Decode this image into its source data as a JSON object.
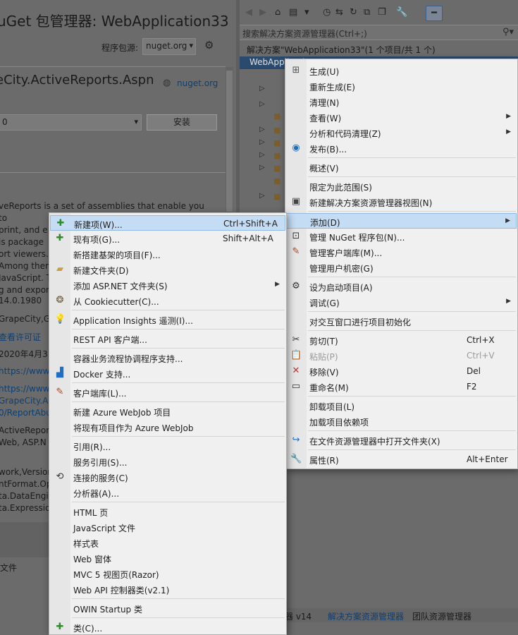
{
  "nuget": {
    "title": "uGet 包管理器: WebApplication33",
    "source_label": "程序包源:",
    "source_value": "nuget.org",
    "package_title": "eCity.ActiveReports.Aspn",
    "package_link": "nuget.org",
    "version_value": "0",
    "install_label": "安装",
    "description_lines": [
      "veReports is a set of assemblies that enable you to",
      "print, and e",
      "is package",
      "ort viewers.",
      "Among them",
      "JavaScript. T",
      "g and expor"
    ],
    "details": [
      {
        "text": "14.0.1980",
        "link": false
      },
      {
        "text": "GrapeCity,G",
        "link": false
      },
      {
        "text": "查看许可证",
        "link": true
      },
      {
        "text": "2020年4月3日",
        "link": false
      },
      {
        "text": "https://www",
        "link": true
      },
      {
        "text": "https://www",
        "link": true
      },
      {
        "text": "GrapeCity.Ac",
        "link": true
      },
      {
        "text": "0/ReportAbu",
        "link": true
      },
      {
        "text": "ActiveRepor",
        "link": false
      },
      {
        "text": "Web, ASP.N",
        "link": false
      },
      {
        "text": "work,Version",
        "link": false
      },
      {
        "text": "ntFormat.Op",
        "link": false
      },
      {
        "text": "ta.DataEngin",
        "link": false
      },
      {
        "text": "ta.Expressio",
        "link": false
      }
    ],
    "file_label": "文件"
  },
  "solution_explorer": {
    "search_placeholder": "搜索解决方案资源管理器(Ctrl+;)",
    "solution_row": "解决方案\"WebApplication33\"(1 个项目/共 1 个)",
    "project_row": "WebApplication33",
    "bottom_tabs": [
      "器 v14",
      "解决方案资源管理器",
      "团队资源管理器"
    ]
  },
  "project_menu": {
    "items": [
      {
        "label": "生成(U)",
        "shortcut": "",
        "icon": "build-icon"
      },
      {
        "label": "重新生成(E)",
        "shortcut": "",
        "icon": ""
      },
      {
        "label": "清理(N)",
        "shortcut": "",
        "icon": ""
      },
      {
        "label": "查看(W)",
        "shortcut": "",
        "icon": "",
        "submenu": true
      },
      {
        "label": "分析和代码清理(Z)",
        "shortcut": "",
        "icon": "",
        "submenu": true
      },
      {
        "label": "发布(B)...",
        "shortcut": "",
        "icon": "globe-icon"
      },
      {
        "label": "概述(V)",
        "shortcut": "",
        "icon": ""
      },
      {
        "label": "限定为此范围(S)",
        "shortcut": "",
        "icon": ""
      },
      {
        "label": "新建解决方案资源管理器视图(N)",
        "shortcut": "",
        "icon": "new-view-icon"
      },
      {
        "label": "添加(D)",
        "shortcut": "",
        "icon": "",
        "submenu": true,
        "highlighted": true
      },
      {
        "label": "管理 NuGet 程序包(N)...",
        "shortcut": "",
        "icon": "nuget-icon"
      },
      {
        "label": "管理客户端库(M)...",
        "shortcut": "",
        "icon": "client-library-icon"
      },
      {
        "label": "管理用户机密(G)",
        "shortcut": "",
        "icon": ""
      },
      {
        "label": "设为启动项目(A)",
        "shortcut": "",
        "icon": "gear-icon"
      },
      {
        "label": "调试(G)",
        "shortcut": "",
        "icon": "",
        "submenu": true
      },
      {
        "label": "对交互窗口进行项目初始化",
        "shortcut": "",
        "icon": ""
      },
      {
        "label": "剪切(T)",
        "shortcut": "Ctrl+X",
        "icon": "scissors-icon"
      },
      {
        "label": "粘贴(P)",
        "shortcut": "Ctrl+V",
        "icon": "paste-icon",
        "disabled": true
      },
      {
        "label": "移除(V)",
        "shortcut": "Del",
        "icon": "remove-icon"
      },
      {
        "label": "重命名(M)",
        "shortcut": "F2",
        "icon": "rename-icon"
      },
      {
        "label": "卸载项目(L)",
        "shortcut": "",
        "icon": ""
      },
      {
        "label": "加载项目依赖项",
        "shortcut": "",
        "icon": ""
      },
      {
        "label": "在文件资源管理器中打开文件夹(X)",
        "shortcut": "",
        "icon": "open-folder-icon"
      },
      {
        "label": "属性(R)",
        "shortcut": "Alt+Enter",
        "icon": "wrench-icon"
      }
    ]
  },
  "add_menu": {
    "items": [
      {
        "label": "新建项(W)...",
        "shortcut": "Ctrl+Shift+A",
        "icon": "new-item-icon",
        "highlighted": true
      },
      {
        "label": "现有项(G)...",
        "shortcut": "Shift+Alt+A",
        "icon": "existing-item-icon"
      },
      {
        "label": "新搭建基架的项目(F)...",
        "shortcut": "",
        "icon": ""
      },
      {
        "label": "新建文件夹(D)",
        "shortcut": "",
        "icon": "new-folder-icon"
      },
      {
        "label": "添加 ASP.NET 文件夹(S)",
        "shortcut": "",
        "icon": "",
        "submenu": true
      },
      {
        "label": "从 Cookiecutter(C)...",
        "shortcut": "",
        "icon": "cookiecutter-icon"
      },
      {
        "label": "Application Insights 遥测(I)...",
        "shortcut": "",
        "icon": "insights-icon"
      },
      {
        "label": "REST API 客户端...",
        "shortcut": "",
        "icon": ""
      },
      {
        "label": "容器业务流程协调程序支持...",
        "shortcut": "",
        "icon": ""
      },
      {
        "label": "Docker 支持...",
        "shortcut": "",
        "icon": "docker-icon"
      },
      {
        "label": "客户端库(L)...",
        "shortcut": "",
        "icon": "client-library-icon"
      },
      {
        "label": "新建 Azure WebJob 项目",
        "shortcut": "",
        "icon": ""
      },
      {
        "label": "将现有项目作为 Azure WebJob",
        "shortcut": "",
        "icon": ""
      },
      {
        "label": "引用(R)...",
        "shortcut": "",
        "icon": ""
      },
      {
        "label": "服务引用(S)...",
        "shortcut": "",
        "icon": ""
      },
      {
        "label": "连接的服务(C)",
        "shortcut": "",
        "icon": "connected-service-icon"
      },
      {
        "label": "分析器(A)...",
        "shortcut": "",
        "icon": ""
      },
      {
        "label": "HTML 页",
        "shortcut": "",
        "icon": ""
      },
      {
        "label": "JavaScript 文件",
        "shortcut": "",
        "icon": ""
      },
      {
        "label": "样式表",
        "shortcut": "",
        "icon": ""
      },
      {
        "label": "Web 窗体",
        "shortcut": "",
        "icon": ""
      },
      {
        "label": "MVC 5 视图页(Razor)",
        "shortcut": "",
        "icon": ""
      },
      {
        "label": "Web API 控制器类(v2.1)",
        "shortcut": "",
        "icon": ""
      },
      {
        "label": "OWIN Startup 类",
        "shortcut": "",
        "icon": ""
      },
      {
        "label": "类(C)...",
        "shortcut": "",
        "icon": "class-icon"
      }
    ]
  }
}
